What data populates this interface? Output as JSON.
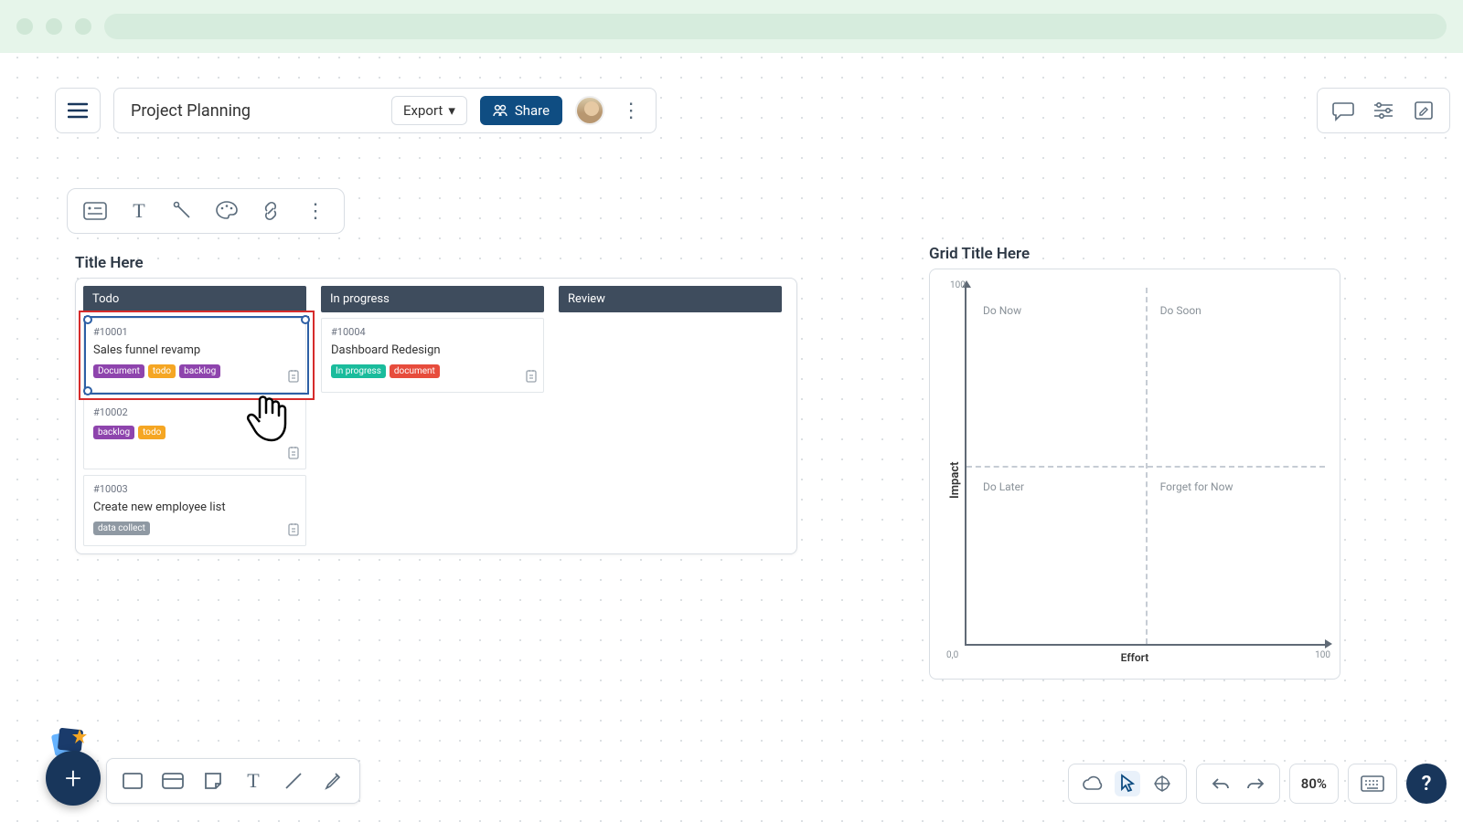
{
  "header": {
    "title": "Project Planning",
    "export_label": "Export",
    "share_label": "Share"
  },
  "kanban": {
    "title": "Title Here",
    "columns": [
      {
        "name": "Todo",
        "cards": [
          {
            "id": "#10001",
            "title": "Sales funnel revamp",
            "tags": [
              {
                "label": "Document",
                "color": "purple"
              },
              {
                "label": "todo",
                "color": "orange"
              },
              {
                "label": "backlog",
                "color": "purple"
              }
            ]
          },
          {
            "id": "#10002",
            "title": "",
            "tags": [
              {
                "label": "backlog",
                "color": "purple"
              },
              {
                "label": "todo",
                "color": "orange"
              }
            ]
          },
          {
            "id": "#10003",
            "title": "Create new employee list",
            "tags": [
              {
                "label": "data collect",
                "color": "gray"
              }
            ]
          }
        ]
      },
      {
        "name": "In progress",
        "cards": [
          {
            "id": "#10004",
            "title": "Dashboard Redesign",
            "tags": [
              {
                "label": "In progress",
                "color": "teal"
              },
              {
                "label": "document",
                "color": "red"
              }
            ]
          }
        ]
      },
      {
        "name": "Review",
        "cards": []
      }
    ]
  },
  "grid": {
    "title": "Grid Title Here",
    "quadrants": {
      "tl": "Do Now",
      "tr": "Do Soon",
      "bl": "Do Later",
      "br": "Forget for Now"
    },
    "x_axis": "Effort",
    "y_axis": "Impact",
    "ticks": {
      "min": "0,0",
      "x_max": "100",
      "y_max": "100"
    }
  },
  "footer": {
    "zoom": "80%",
    "help": "?"
  },
  "chart_data": {
    "type": "scatter",
    "title": "Grid Title Here",
    "xlabel": "Effort",
    "ylabel": "Impact",
    "xlim": [
      0,
      100
    ],
    "ylim": [
      0,
      100
    ],
    "quadrants": [
      {
        "label": "Do Now",
        "x_range": [
          0,
          50
        ],
        "y_range": [
          50,
          100
        ]
      },
      {
        "label": "Do Soon",
        "x_range": [
          50,
          100
        ],
        "y_range": [
          50,
          100
        ]
      },
      {
        "label": "Do Later",
        "x_range": [
          0,
          50
        ],
        "y_range": [
          0,
          50
        ]
      },
      {
        "label": "Forget for Now",
        "x_range": [
          50,
          100
        ],
        "y_range": [
          0,
          50
        ]
      }
    ],
    "series": []
  }
}
